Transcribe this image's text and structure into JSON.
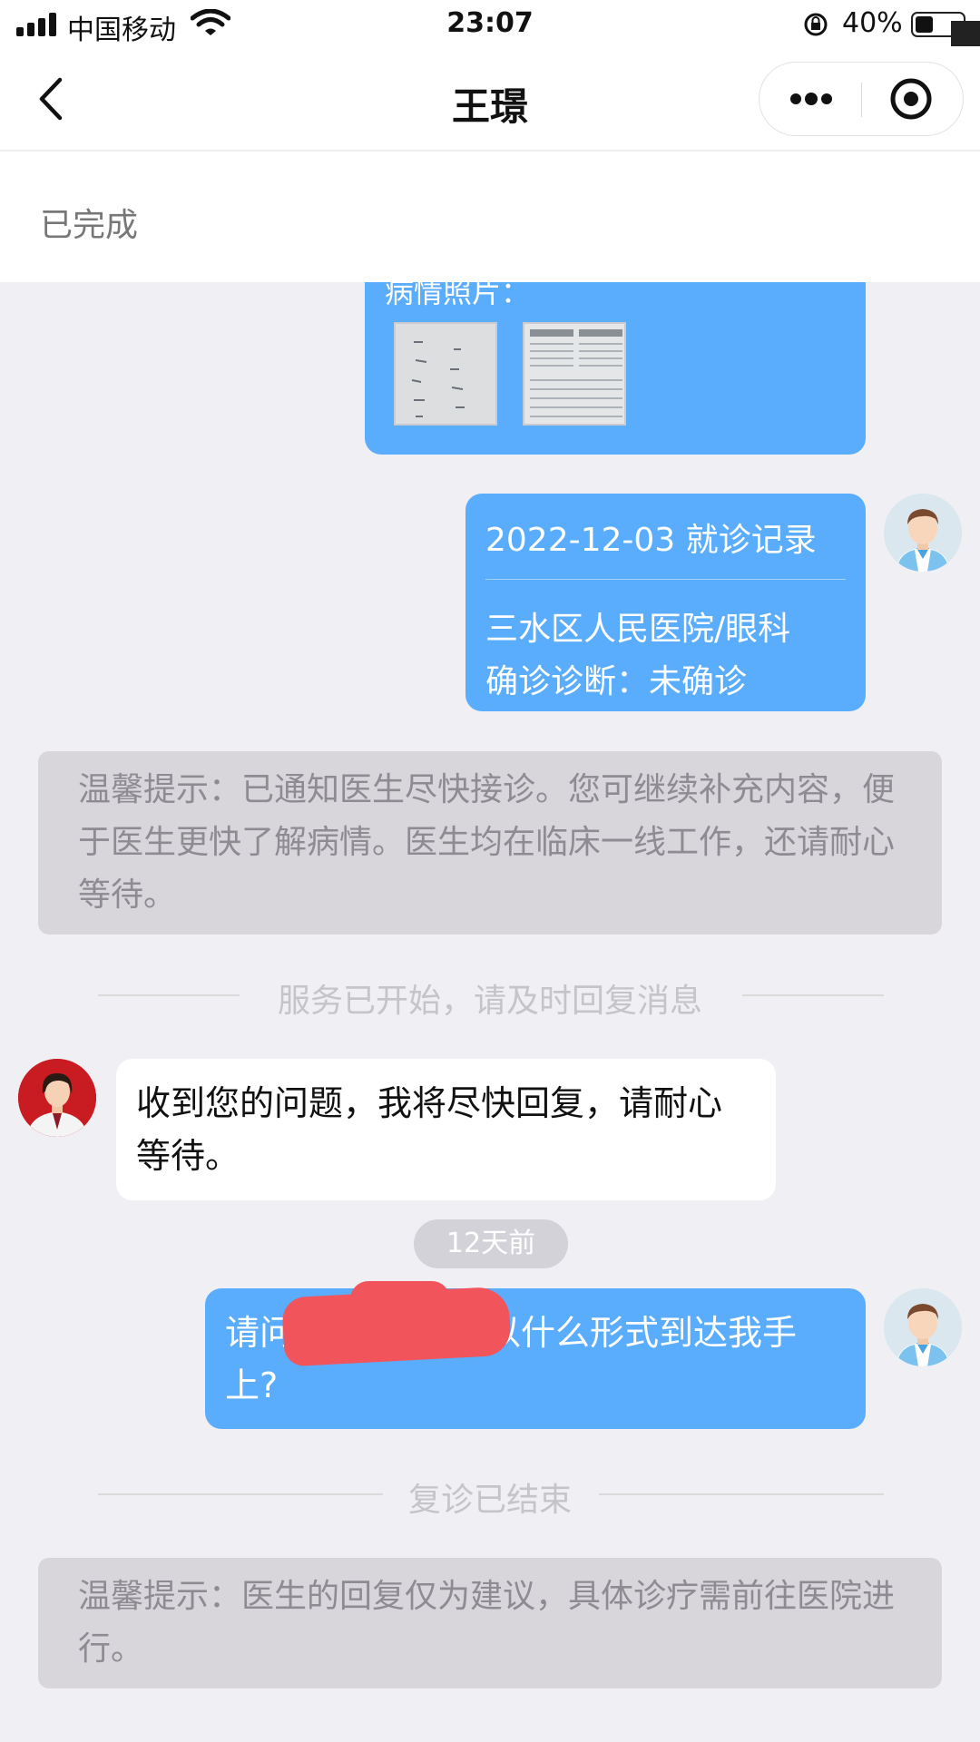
{
  "status_bar": {
    "carrier": "中国移动",
    "time": "23:07",
    "battery": "40%",
    "battery_level": 0.4,
    "icons": [
      "signal-icon",
      "wifi-icon",
      "rotation-lock-icon",
      "battery-icon"
    ]
  },
  "nav": {
    "title": "王璟",
    "icons": [
      "back-chevron-icon",
      "more-dots-icon",
      "close-target-icon"
    ]
  },
  "status_header": {
    "text": "已完成"
  },
  "chat": {
    "photo_card": {
      "label": "病情照片：",
      "thumb_count": 2
    },
    "record_card": {
      "title": "2022-12-03 就诊记录",
      "hospital": "三水区人民医院/眼科",
      "diagnosis": "确诊诊断：未确诊"
    },
    "tip_1": "温馨提示：已通知医生尽快接诊。您可继续补充内容，便于医生更快了解病情。医生均在临床一线工作，还请耐心等待。",
    "divider_1": "服务已开始，请及时回复消息",
    "doctor_message": "收到您的问题，我将尽快回复，请耐心等待。",
    "time_pill": "12天前",
    "user_message": {
      "prefix": "请问",
      "suffix": "以什么形式到达我手上?"
    },
    "divider_2": "复诊已结束",
    "tip_2": "温馨提示：医生的回复仅为建议，具体诊疗需前往医院进行。"
  },
  "colors": {
    "user_bubble": "#5aacfd",
    "tip_bg": "#d8d6db",
    "chat_bg": "#f0eff4",
    "doctor_avatar_bg": "#c91c22",
    "redaction": "#f2545b"
  }
}
